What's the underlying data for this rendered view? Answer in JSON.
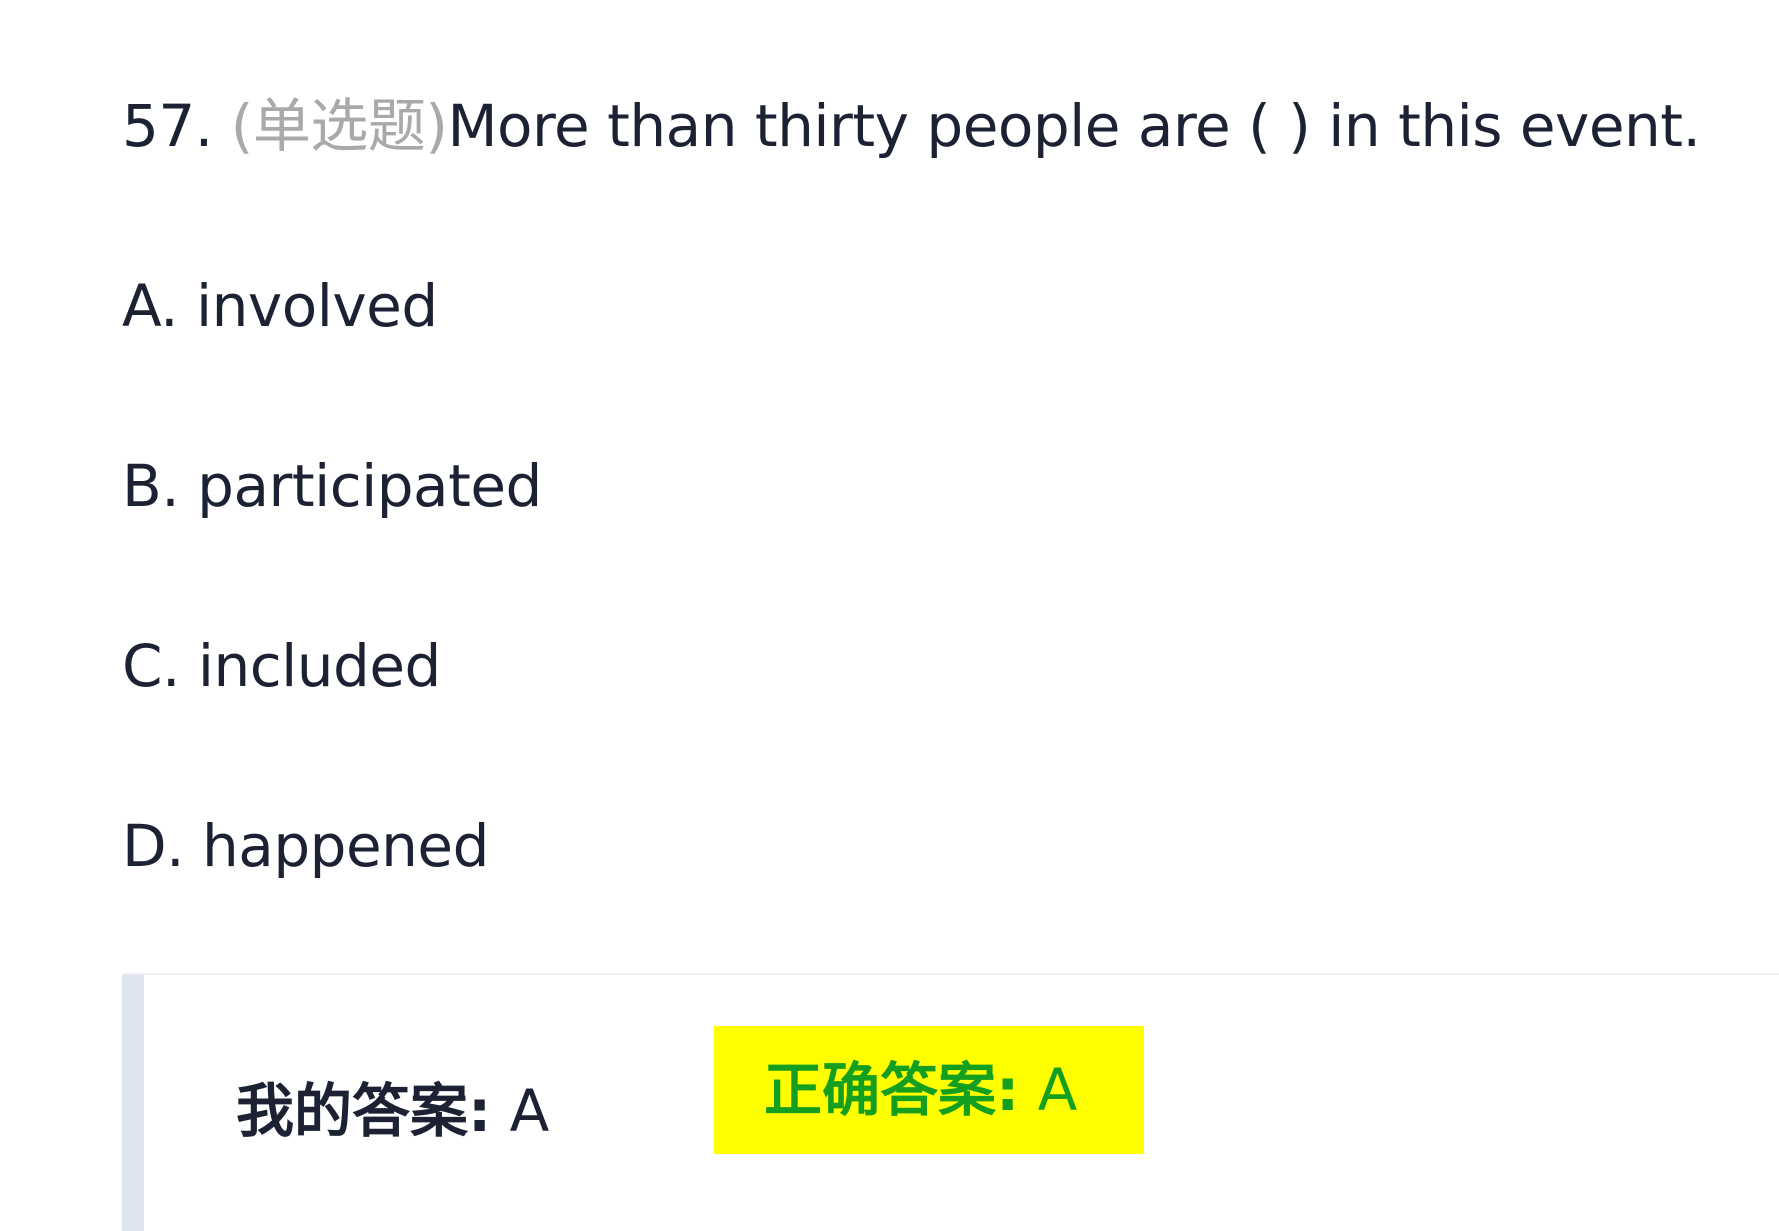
{
  "question": {
    "number": "57. ",
    "type": "(单选题)",
    "text": "More than thirty people are ( ) in this event."
  },
  "options": [
    {
      "label": "A. involved"
    },
    {
      "label": "B. participated"
    },
    {
      "label": "C. included"
    },
    {
      "label": "D. happened"
    }
  ],
  "answers": {
    "my_label": "我的答案:",
    "my_value": " A",
    "correct_label": "正确答案:",
    "correct_value": " A"
  },
  "colors": {
    "question_type": "#a9a9a9",
    "correct_highlight": "#ffff00",
    "correct_text": "#14a01e",
    "answer_bar": "#dfe5f0"
  }
}
